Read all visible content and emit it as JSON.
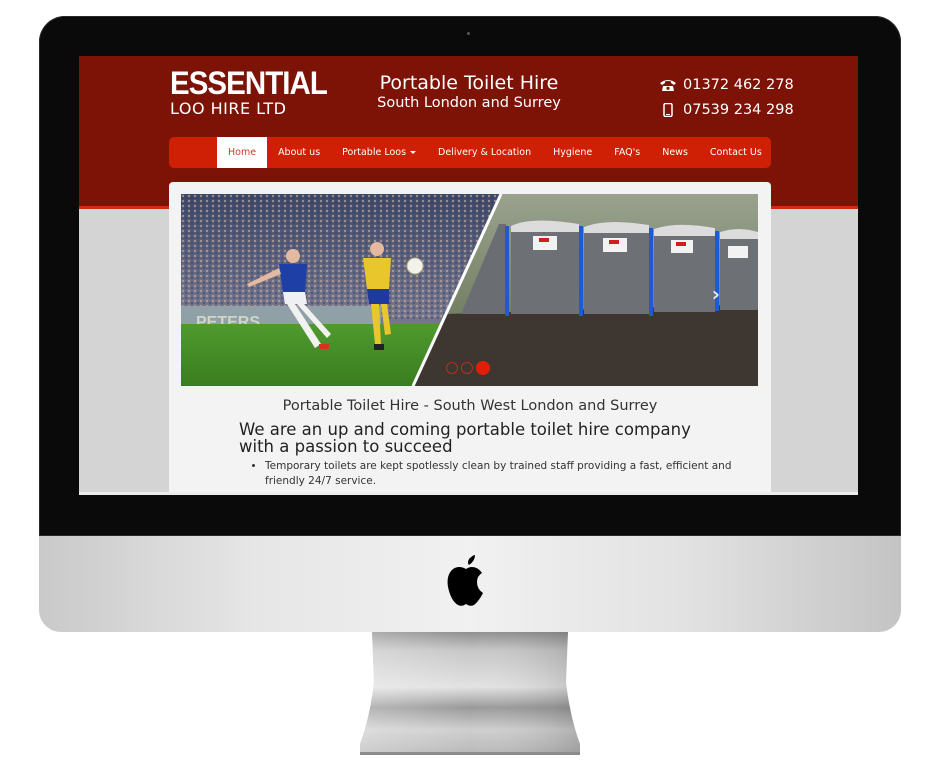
{
  "site": {
    "logo": {
      "line1": "ESSENTIAL",
      "line2": "LOO HIRE LTD"
    },
    "tagline": {
      "line1": "Portable Toilet Hire",
      "line2": "South London and Surrey"
    },
    "phones": [
      {
        "icon": "telephone-icon",
        "number": "01372 462 278"
      },
      {
        "icon": "mobile-phone-icon",
        "number": "07539 234 298"
      }
    ],
    "nav": [
      {
        "label": "Home",
        "active": true
      },
      {
        "label": "About us"
      },
      {
        "label": "Portable Loos",
        "dropdown": true
      },
      {
        "label": "Delivery & Location"
      },
      {
        "label": "Hygiene"
      },
      {
        "label": "FAQ's"
      },
      {
        "label": "News"
      },
      {
        "label": "Contact Us"
      }
    ],
    "slider": {
      "slides": [
        "football-match-image",
        "portable-toilets-image"
      ],
      "active_slide_index": 3,
      "slide_count": 3,
      "next_icon": "chevron-right-icon"
    },
    "content": {
      "title": "Portable Toilet Hire - South West London and Surrey",
      "heading": "We are an up and coming portable toilet hire company with a passion to succeed",
      "bullets": [
        "Temporary toilets are kept spotlessly clean by trained staff providing a fast, efficient and friendly 24/7 service."
      ]
    }
  },
  "device": {
    "brand_icon": "apple-logo-icon"
  },
  "colors": {
    "header_bg": "#7d1306",
    "nav_bg": "#cf1f04",
    "accent": "#e01f0a",
    "panel_bg": "#f3f3f3",
    "page_bg": "#d4d4d4"
  }
}
